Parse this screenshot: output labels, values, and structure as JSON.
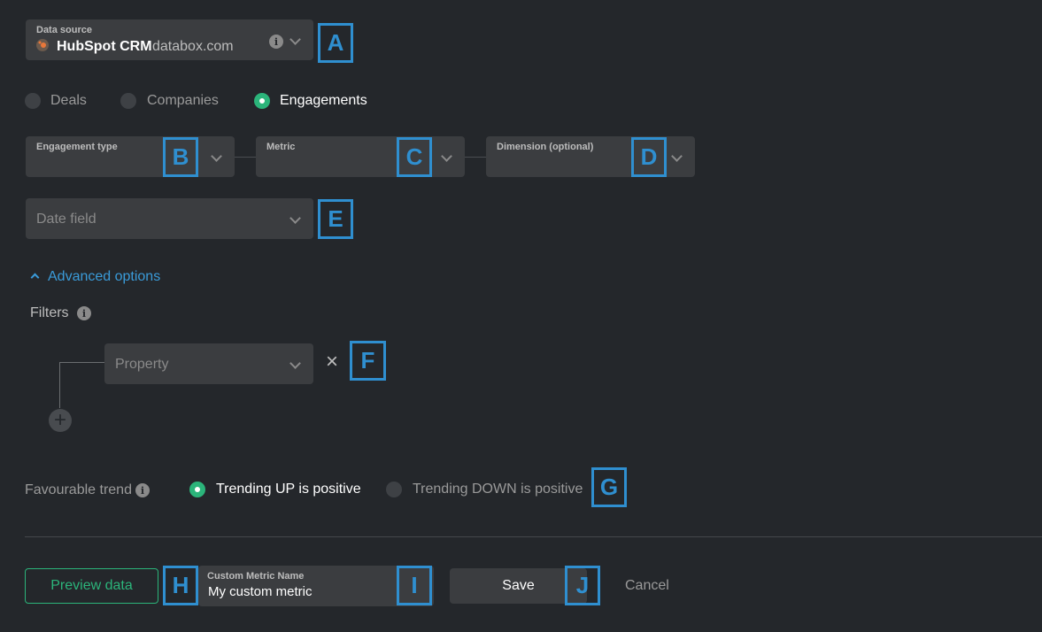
{
  "data_source": {
    "label": "Data source",
    "name": "HubSpot CRM",
    "domain": "databox.com",
    "icon": "hubspot-icon",
    "info_icon": "i"
  },
  "object_tabs": [
    {
      "label": "Deals",
      "selected": false
    },
    {
      "label": "Companies",
      "selected": false
    },
    {
      "label": "Engagements",
      "selected": true
    }
  ],
  "selectors": {
    "engagement_type": "Engagement type",
    "metric": "Metric",
    "dimension": "Dimension (optional)"
  },
  "date_field": {
    "placeholder": "Date field"
  },
  "advanced": {
    "label": "Advanced options"
  },
  "filters": {
    "label": "Filters",
    "info_icon": "i",
    "property_placeholder": "Property",
    "remove_icon": "×",
    "add_icon": "+"
  },
  "trend": {
    "label": "Favourable trend",
    "info_icon": "i",
    "options": [
      {
        "label": "Trending UP is positive",
        "selected": true
      },
      {
        "label": "Trending DOWN is positive",
        "selected": false
      }
    ]
  },
  "footer": {
    "preview_label": "Preview data",
    "name_label": "Custom Metric Name",
    "name_value": "My custom metric",
    "save_label": "Save",
    "cancel_label": "Cancel"
  },
  "markers": [
    "A",
    "B",
    "C",
    "D",
    "E",
    "F",
    "G",
    "H",
    "I",
    "J"
  ],
  "colors": {
    "accent_green": "#2bb47a",
    "marker_blue": "#2f8fd0",
    "link_blue": "#3a9bd9",
    "background": "#24272b"
  }
}
